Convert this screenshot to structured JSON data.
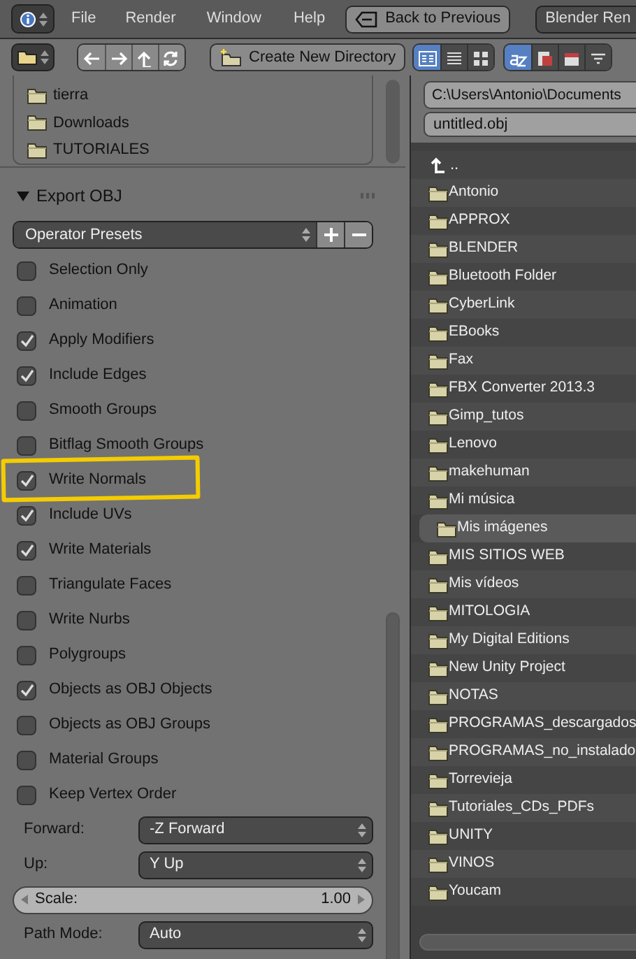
{
  "menu_bar": {
    "menus": [
      "File",
      "Render",
      "Window",
      "Help"
    ],
    "back_button": "Back to Previous",
    "engine": "Blender Ren"
  },
  "toolbar": {
    "create_directory": "Create New Directory",
    "display_modes": [
      {
        "kind": "short",
        "selected": true
      },
      {
        "kind": "long",
        "selected": false
      },
      {
        "kind": "thumbnails",
        "selected": false
      }
    ],
    "sort_modes": [
      {
        "kind": "alpha",
        "selected": true
      },
      {
        "kind": "extension",
        "selected": false
      },
      {
        "kind": "time",
        "selected": false
      },
      {
        "kind": "size",
        "selected": false
      }
    ]
  },
  "bookmarks": [
    "tierra",
    "Downloads",
    "TUTORIALES"
  ],
  "export_panel": {
    "title": "Export OBJ",
    "expanded": true,
    "presets": "Operator Presets",
    "options": [
      {
        "label": "Selection Only",
        "checked": false,
        "highlighted": false
      },
      {
        "label": "Animation",
        "checked": false,
        "highlighted": false
      },
      {
        "label": "Apply Modifiers",
        "checked": true,
        "highlighted": false
      },
      {
        "label": "Include Edges",
        "checked": true,
        "highlighted": false
      },
      {
        "label": "Smooth Groups",
        "checked": false,
        "highlighted": false
      },
      {
        "label": "Bitflag Smooth Groups",
        "checked": false,
        "highlighted": false
      },
      {
        "label": "Write Normals",
        "checked": true,
        "highlighted": true
      },
      {
        "label": "Include UVs",
        "checked": true,
        "highlighted": false
      },
      {
        "label": "Write Materials",
        "checked": true,
        "highlighted": false
      },
      {
        "label": "Triangulate Faces",
        "checked": false,
        "highlighted": false
      },
      {
        "label": "Write Nurbs",
        "checked": false,
        "highlighted": false
      },
      {
        "label": "Polygroups",
        "checked": false,
        "highlighted": false
      },
      {
        "label": "Objects as OBJ Objects",
        "checked": true,
        "highlighted": false
      },
      {
        "label": "Objects as OBJ Groups",
        "checked": false,
        "highlighted": false
      },
      {
        "label": "Material Groups",
        "checked": false,
        "highlighted": false
      },
      {
        "label": "Keep Vertex Order",
        "checked": false,
        "highlighted": false
      }
    ],
    "settings": [
      {
        "kind": "dropdown",
        "label": "Forward:",
        "value": "-Z Forward"
      },
      {
        "kind": "dropdown",
        "label": "Up:",
        "value": "Y Up"
      },
      {
        "kind": "number",
        "label": "Scale:",
        "value": "1.00"
      },
      {
        "kind": "dropdown",
        "label": "Path Mode:",
        "value": "Auto"
      }
    ]
  },
  "file_browser": {
    "path": "C:\\Users\\Antonio\\Documents",
    "filename": "untitled.obj",
    "parent": "..",
    "folders": [
      {
        "name": "Antonio",
        "selected": false
      },
      {
        "name": "APPROX",
        "selected": false
      },
      {
        "name": "BLENDER",
        "selected": false
      },
      {
        "name": "Bluetooth Folder",
        "selected": false
      },
      {
        "name": "CyberLink",
        "selected": false
      },
      {
        "name": "EBooks",
        "selected": false
      },
      {
        "name": "Fax",
        "selected": false
      },
      {
        "name": "FBX Converter 2013.3",
        "selected": false
      },
      {
        "name": "Gimp_tutos",
        "selected": false
      },
      {
        "name": "Lenovo",
        "selected": false
      },
      {
        "name": "makehuman",
        "selected": false
      },
      {
        "name": "Mi música",
        "selected": false
      },
      {
        "name": "Mis imágenes",
        "selected": true
      },
      {
        "name": "MIS SITIOS WEB",
        "selected": false
      },
      {
        "name": "Mis vídeos",
        "selected": false
      },
      {
        "name": "MITOLOGIA",
        "selected": false
      },
      {
        "name": "My Digital Editions",
        "selected": false
      },
      {
        "name": "New Unity Project",
        "selected": false
      },
      {
        "name": "NOTAS",
        "selected": false
      },
      {
        "name": "PROGRAMAS_descargados",
        "selected": false
      },
      {
        "name": "PROGRAMAS_no_instalado",
        "selected": false
      },
      {
        "name": "Torrevieja",
        "selected": false
      },
      {
        "name": "Tutoriales_CDs_PDFs",
        "selected": false
      },
      {
        "name": "UNITY",
        "selected": false
      },
      {
        "name": "VINOS",
        "selected": false
      },
      {
        "name": "Youcam",
        "selected": false
      }
    ]
  }
}
